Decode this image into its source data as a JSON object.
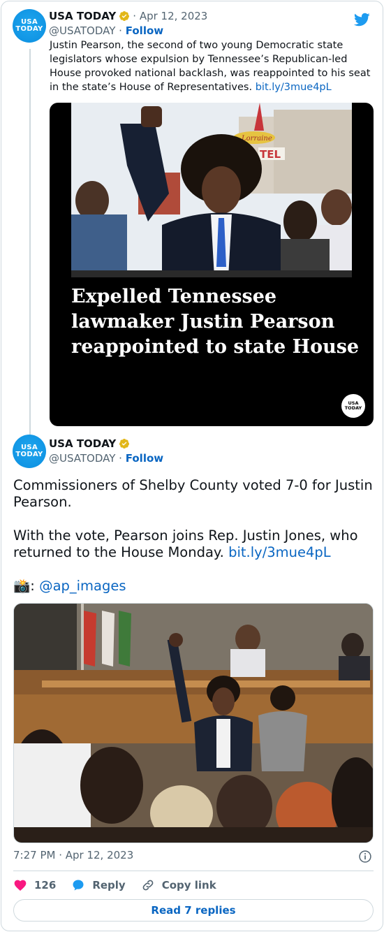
{
  "quoted_tweet": {
    "avatar_lines": [
      "USA",
      "TODAY"
    ],
    "display_name": "USA TODAY",
    "date": "· Apr 12, 2023",
    "handle": "@USATODAY",
    "separator": "·",
    "follow_label": "Follow",
    "text": "Justin Pearson, the second of two young Democratic state legislators whose expulsion by Tennessee’s Republican-led House provoked national backlash, was reappointed to his seat in the state’s House of Representatives.",
    "link": "bit.ly/3mue4pL",
    "media": {
      "sign_text": "Lorraine",
      "sign_text2": "TEL",
      "headline_lines": [
        "Expelled Tennessee",
        "lawmaker Justin Pearson",
        "reappointed to state House"
      ],
      "badge_lines": [
        "USA",
        "TODAY"
      ]
    }
  },
  "main_tweet": {
    "avatar_lines": [
      "USA",
      "TODAY"
    ],
    "display_name": "USA TODAY",
    "handle": "@USATODAY",
    "separator": "·",
    "follow_label": "Follow",
    "paragraph1": "Commissioners of Shelby County voted 7-0 for Justin Pearson.",
    "paragraph2": "With the vote, Pearson joins Rep. Justin Jones, who returned to the House Monday.",
    "link": "bit.ly/3mue4pL",
    "camera_emoji": "📸",
    "credit_prefix": ":",
    "credit_handle": "@ap_images",
    "timestamp": "7:27 PM · Apr 12, 2023"
  },
  "actions": {
    "like_count": "126",
    "reply_label": "Reply",
    "copy_label": "Copy link"
  },
  "read_replies_label": "Read 7 replies",
  "colors": {
    "link": "#0a66c2",
    "verified": "#e2b719",
    "heart": "#f91880",
    "twitter_blue": "#1d9bf0"
  },
  "icons": [
    "verified-badge-icon",
    "twitter-bird-icon",
    "info-icon",
    "heart-icon",
    "reply-bubble-icon",
    "link-icon"
  ]
}
